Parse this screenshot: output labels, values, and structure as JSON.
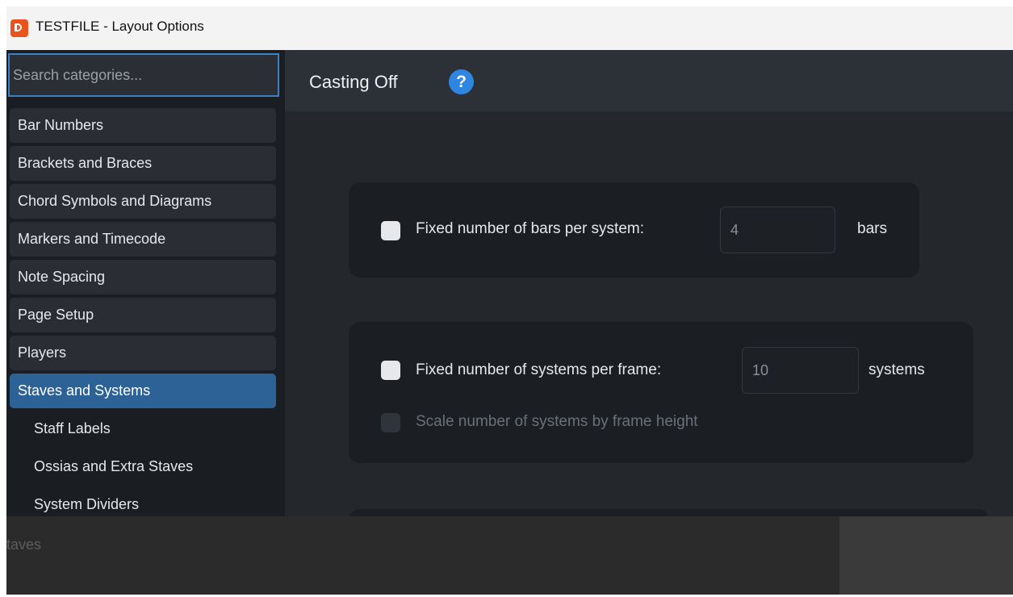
{
  "window": {
    "title": "TESTFILE - Layout Options"
  },
  "search": {
    "placeholder": "Search categories..."
  },
  "categories": [
    {
      "label": "Bar Numbers"
    },
    {
      "label": "Brackets and Braces"
    },
    {
      "label": "Chord Symbols and Diagrams"
    },
    {
      "label": "Markers and Timecode"
    },
    {
      "label": "Note Spacing"
    },
    {
      "label": "Page Setup"
    },
    {
      "label": "Players"
    },
    {
      "label": "Staves and Systems"
    },
    {
      "label": "Staff Labels"
    },
    {
      "label": "Ossias and Extra Staves"
    },
    {
      "label": "System Dividers"
    }
  ],
  "content": {
    "title": "Casting Off",
    "help": "?",
    "options": {
      "bars": {
        "label": "Fixed number of bars per system:",
        "value": "4",
        "unit": "bars"
      },
      "systems": {
        "label": "Fixed number of systems per frame:",
        "value": "10",
        "unit": "systems"
      },
      "scale": {
        "label": "Scale number of systems by frame height"
      }
    }
  },
  "background": {
    "text": "taves"
  },
  "colors": {
    "accent": "#3c82c4",
    "selected": "#2d6296",
    "help": "#2f86e0"
  }
}
